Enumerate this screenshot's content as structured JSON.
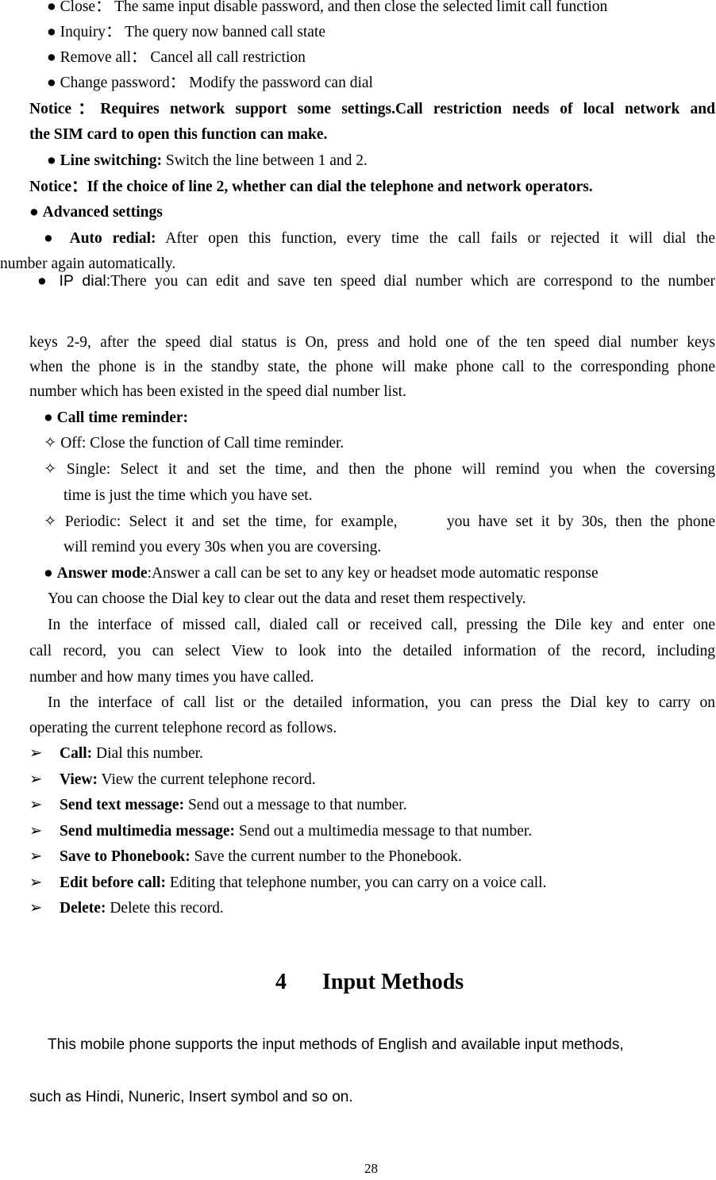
{
  "call_barring_items": [
    {
      "label": "Close",
      "sep": "：",
      "text": "The same input disable password, and then close the selected limit call function"
    },
    {
      "label": "Inquiry",
      "sep": "：",
      "text": "The query now banned call state"
    },
    {
      "label": "Remove all",
      "sep": "：",
      "text": "Cancel all call restriction"
    },
    {
      "label": "Change password",
      "sep": "：",
      "text": "Modify the password can dial"
    }
  ],
  "notice1": {
    "label": "Notice：",
    "line1": "Requires network support some settings.Call restriction needs of local network and",
    "line2": "the SIM card to open this function can make."
  },
  "line_switching": {
    "label": "Line switching:",
    "text": " Switch the line between 1 and 2."
  },
  "notice2": {
    "label": "Notice：",
    "text": "If the choice of line 2, whether can dial the telephone and network operators."
  },
  "advanced_settings": {
    "label": "Advanced settings"
  },
  "auto_redial": {
    "label": "Auto redial:",
    "line1": " After open this function, every time the call fails or rejected it will dial the",
    "line2": "number again automatically."
  },
  "ip_dial": {
    "label": "IP dial:",
    "line1": "There you can edit and save ten speed dial number which are correspond to the number",
    "line2": "keys 2-9, after the speed dial status is On, press and hold one of the ten speed dial number keys",
    "line3": "when the phone is in the standby state, the phone will make phone call to the corresponding phone",
    "line4": "number which has been existed in the speed dial number list."
  },
  "call_time_reminder": {
    "label": "Call time reminder:",
    "options": [
      {
        "line1": "Off: Close the function of Call time reminder.",
        "line2": ""
      },
      {
        "line1": "Single: Select it and set the time, and then the phone will remind you when the coversing",
        "line2": "time is just the time which you have set."
      },
      {
        "line1": "Periodic: Select it and set the time, for example,      you have set it by 30s, then the phone",
        "line2": "will remind you every 30s when you are coversing."
      }
    ]
  },
  "answer_mode": {
    "label": "Answer mode",
    "text": ":Answer a call can be set to any key or headset mode automatic response"
  },
  "paragraphs": {
    "p1": "You can choose the Dial key to clear out the data and reset them respectively.",
    "p2_line1": "In the interface of missed call, dialed call or received call, pressing the Dile key and enter one",
    "p2_line2": "call record, you can select View to look into the detailed information of the record, including",
    "p2_line3": "number and how many times you have called.",
    "p3_line1": "In the interface of call list or the detailed information, you can press the Dial key to carry on",
    "p3_line2": "operating the current telephone record as follows."
  },
  "record_options": [
    {
      "label": "Call:",
      "text": " Dial this number."
    },
    {
      "label": "View:",
      "text": " View the current telephone record."
    },
    {
      "label": "Send text message:",
      "text": " Send out a message to that number."
    },
    {
      "label": "Send multimedia message:",
      "text": " Send out a multimedia message to that number."
    },
    {
      "label": "Save to Phonebook:",
      "text": " Save the current number to the Phonebook."
    },
    {
      "label": "Edit before call:",
      "text": " Editing that telephone number, you can carry on a voice call."
    },
    {
      "label": "Delete:",
      "text": " Delete this record."
    }
  ],
  "section": {
    "number": "4",
    "title": "Input Methods"
  },
  "input_methods": {
    "line1": "This mobile phone supports the input methods of English and available input methods,",
    "line2": "such as Hindi, Nuneric, Insert symbol and so on."
  },
  "icons": {
    "bullet": "●",
    "diamond": "✧",
    "arrow": "➢"
  },
  "page_number": "28"
}
